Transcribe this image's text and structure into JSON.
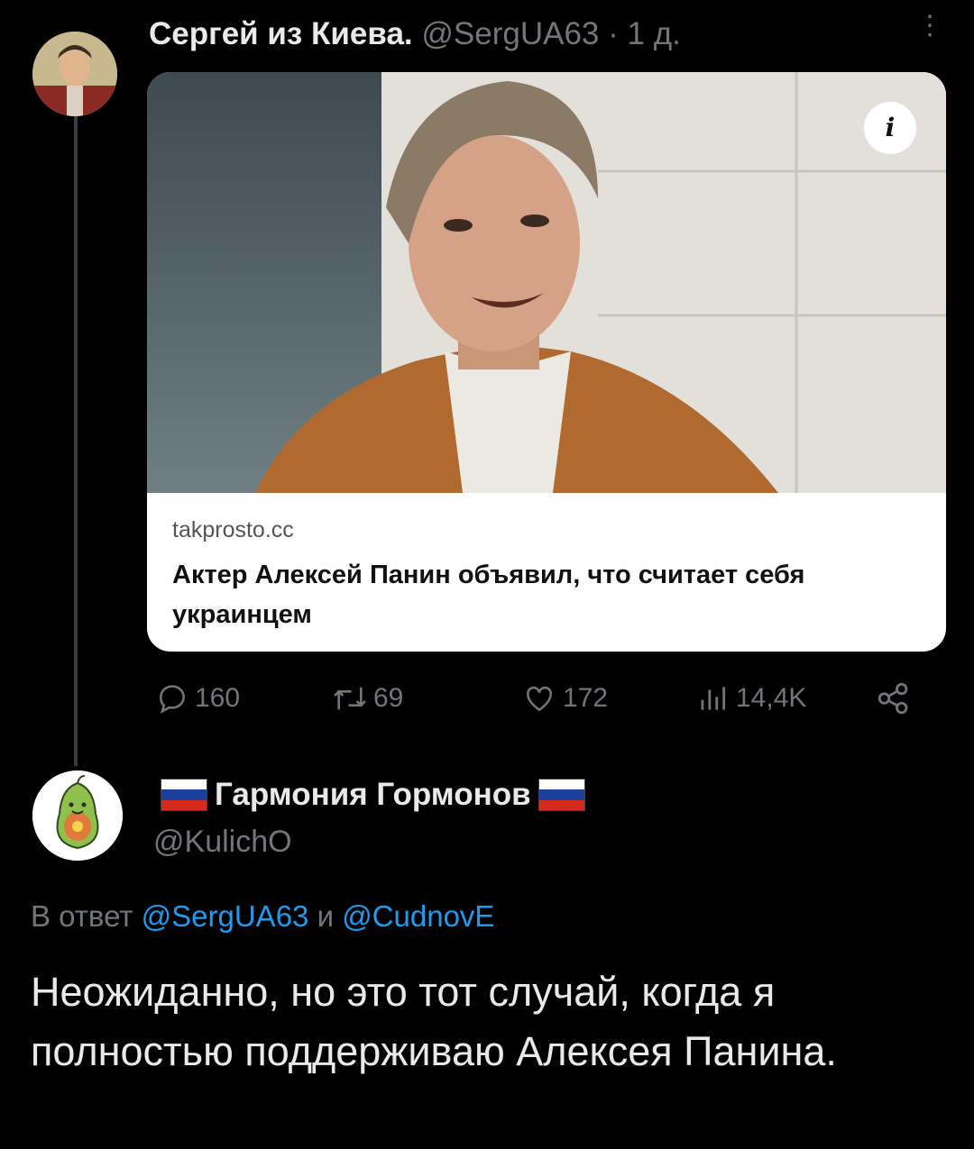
{
  "tweet": {
    "author_name": "Сергей из Киева.",
    "author_handle": "@SergUA63",
    "time": "· 1 д.",
    "more_icon": "more-vertical-icon",
    "card": {
      "domain": "takprosto.cc",
      "headline": "Актер Алексей Панин объявил, что считает себя украинцем",
      "info_label": "i"
    },
    "actions": {
      "replies": "160",
      "retweets": "69",
      "likes": "172",
      "views": "14,4K"
    }
  },
  "reply": {
    "author_name": "Гармония Гормонов",
    "author_handle": "@KulichO",
    "reply_prefix": "В ответ",
    "reply_user1": "@SergUA63",
    "reply_and": "и",
    "reply_user2": "@CudnovE",
    "text": "Неожиданно, но это тот случай, когда я полностью поддерживаю Алексея Панина."
  },
  "colors": {
    "background": "#000000",
    "muted": "#71767b",
    "link": "#1d9bf0",
    "flag_white": "#ffffff",
    "flag_blue": "#1c3f9c",
    "flag_red": "#d52b1e"
  }
}
